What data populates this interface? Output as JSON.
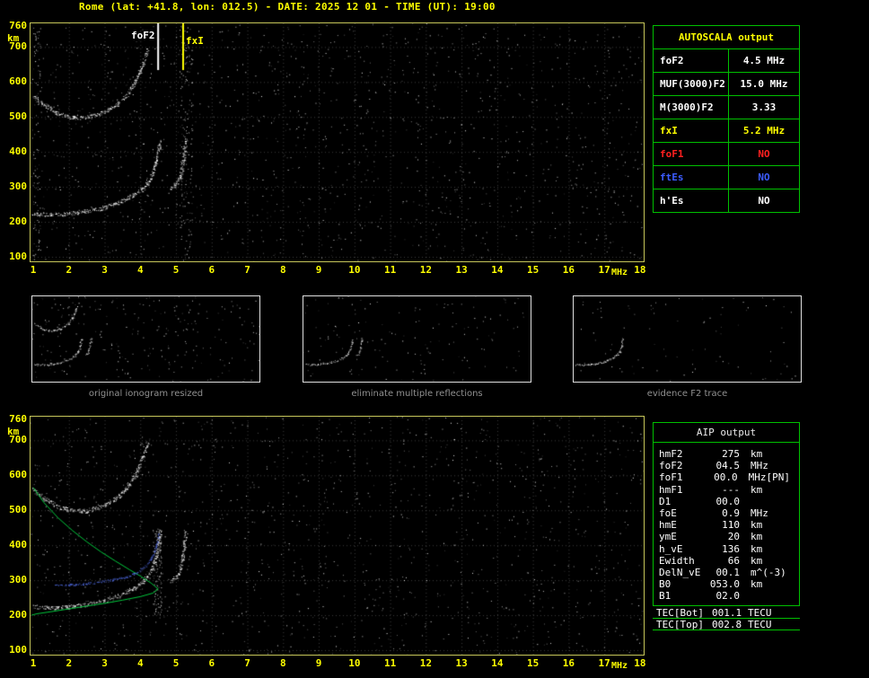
{
  "title": "Rome (lat: +41.8, lon: 012.5) - DATE: 2025 12 01 - TIME (UT): 19:00",
  "colors": {
    "accent_yellow": "#ffff00",
    "table_border_green": "#00c000",
    "plot_frame_yellow": "#c6c65a",
    "caption_gray": "#909090",
    "profile_green": "#00c83c",
    "scaled_trace_blue": "#5a78ff",
    "no_red": "#ff2020",
    "es_blue": "#3c5cff"
  },
  "autoscala": {
    "title": "AUTOSCALA output",
    "rows": [
      {
        "label": "foF2",
        "value": "4.5 MHz",
        "color": "#ffffff"
      },
      {
        "label": "MUF(3000)F2",
        "value": "15.0 MHz",
        "color": "#ffffff"
      },
      {
        "label": "M(3000)F2",
        "value": "3.33",
        "color": "#ffffff"
      },
      {
        "label": "fxI",
        "value": "5.2 MHz",
        "color": "#ffff00"
      },
      {
        "label": "foF1",
        "value": "NO",
        "color": "#ff2020"
      },
      {
        "label": "ftEs",
        "value": "NO",
        "color": "#3c5cff"
      },
      {
        "label": "h'Es",
        "value": "NO",
        "color": "#ffffff"
      }
    ]
  },
  "aip": {
    "title": "AIP output",
    "rows": [
      {
        "label": "hmF2",
        "value": "275",
        "unit": "km",
        "note": ""
      },
      {
        "label": "foF2",
        "value": "04.5",
        "unit": "MHz",
        "note": ""
      },
      {
        "label": "foF1",
        "value": "00.0",
        "unit": "MHz",
        "note": "[PN]"
      },
      {
        "label": "hmF1",
        "value": "---",
        "unit": "km",
        "note": ""
      },
      {
        "label": "D1",
        "value": "00.0",
        "unit": "",
        "note": ""
      },
      {
        "label": "foE",
        "value": "0.9",
        "unit": "MHz",
        "note": ""
      },
      {
        "label": "hmE",
        "value": "110",
        "unit": "km",
        "note": ""
      },
      {
        "label": "ymE",
        "value": "20",
        "unit": "km",
        "note": ""
      },
      {
        "label": "h_vE",
        "value": "136",
        "unit": "km",
        "note": ""
      },
      {
        "label": "Ewidth",
        "value": "66",
        "unit": "km",
        "note": ""
      },
      {
        "label": "DelN_vE",
        "value": "00.1",
        "unit": "m^(-3)",
        "note": ""
      },
      {
        "label": "B0",
        "value": "053.0",
        "unit": "km",
        "note": ""
      },
      {
        "label": "B1",
        "value": "02.0",
        "unit": "",
        "note": ""
      }
    ],
    "tec_rows": [
      {
        "label": "TEC[Bot]",
        "value": "001.1",
        "unit": "TECU"
      },
      {
        "label": "TEC[Top]",
        "value": "002.8",
        "unit": "TECU"
      }
    ]
  },
  "thumbnails": [
    {
      "caption": "original ionogram resized"
    },
    {
      "caption": "eliminate multiple reflections"
    },
    {
      "caption": "evidence F2 trace"
    }
  ],
  "chart_data": [
    {
      "name": "main-ionogram",
      "type": "scatter",
      "xlabel": "MHz",
      "ylabel": "km",
      "xlim": [
        1,
        18
      ],
      "ylim": [
        100,
        760
      ],
      "grid": true,
      "x_ticks": [
        1,
        2,
        3,
        4,
        5,
        6,
        7,
        8,
        9,
        10,
        11,
        12,
        13,
        14,
        15,
        16,
        17,
        18
      ],
      "y_ticks": [
        760,
        700,
        600,
        500,
        400,
        300,
        200,
        100
      ],
      "markers": [
        {
          "label": "foF2",
          "MHz": 4.5,
          "color": "#ffffff"
        },
        {
          "label": "fxI",
          "MHz": 5.2,
          "color": "#ffff00"
        }
      ],
      "traces": [
        {
          "name": "F2-first-hop",
          "color": "#ffffff",
          "points": [
            [
              1.0,
              225
            ],
            [
              1.5,
              221
            ],
            [
              2.0,
              224
            ],
            [
              2.5,
              231
            ],
            [
              3.0,
              242
            ],
            [
              3.4,
              256
            ],
            [
              3.8,
              276
            ],
            [
              4.1,
              300
            ],
            [
              4.3,
              328
            ],
            [
              4.45,
              372
            ],
            [
              4.55,
              432
            ]
          ]
        },
        {
          "name": "F2-second-hop",
          "color": "#ffffff",
          "points": [
            [
              1.0,
              560
            ],
            [
              1.3,
              534
            ],
            [
              1.7,
              510
            ],
            [
              2.1,
              499
            ],
            [
              2.5,
              499
            ],
            [
              2.9,
              511
            ],
            [
              3.3,
              533
            ],
            [
              3.6,
              561
            ],
            [
              3.85,
              601
            ],
            [
              4.05,
              648
            ],
            [
              4.2,
              692
            ]
          ]
        },
        {
          "name": "X-mode-segment",
          "color": "#ffffff",
          "points": [
            [
              4.85,
              298
            ],
            [
              5.0,
              309
            ],
            [
              5.1,
              329
            ],
            [
              5.18,
              364
            ],
            [
              5.23,
              408
            ],
            [
              5.26,
              438
            ]
          ]
        }
      ]
    },
    {
      "name": "profile-ionogram",
      "type": "scatter",
      "xlabel": "MHz",
      "ylabel": "km",
      "xlim": [
        1,
        18
      ],
      "ylim": [
        100,
        760
      ],
      "grid": true,
      "x_ticks": [
        1,
        2,
        3,
        4,
        5,
        6,
        7,
        8,
        9,
        10,
        11,
        12,
        13,
        14,
        15,
        16,
        17,
        18
      ],
      "y_ticks": [
        760,
        700,
        600,
        500,
        400,
        300,
        200,
        100
      ],
      "traces": [
        {
          "name": "F2-first-hop",
          "color": "#ffffff",
          "points": [
            [
              1.0,
              225
            ],
            [
              1.5,
              221
            ],
            [
              2.0,
              224
            ],
            [
              2.5,
              231
            ],
            [
              3.0,
              242
            ],
            [
              3.4,
              256
            ],
            [
              3.8,
              276
            ],
            [
              4.1,
              300
            ],
            [
              4.3,
              328
            ],
            [
              4.45,
              372
            ],
            [
              4.55,
              432
            ]
          ]
        },
        {
          "name": "F2-second-hop",
          "color": "#ffffff",
          "points": [
            [
              1.0,
              560
            ],
            [
              1.3,
              534
            ],
            [
              1.7,
              510
            ],
            [
              2.1,
              499
            ],
            [
              2.5,
              499
            ],
            [
              2.9,
              511
            ],
            [
              3.3,
              533
            ],
            [
              3.6,
              561
            ],
            [
              3.85,
              601
            ],
            [
              4.05,
              648
            ],
            [
              4.2,
              692
            ]
          ]
        },
        {
          "name": "X-mode-segment",
          "color": "#ffffff",
          "points": [
            [
              4.85,
              298
            ],
            [
              5.0,
              309
            ],
            [
              5.1,
              329
            ],
            [
              5.18,
              364
            ],
            [
              5.23,
              408
            ],
            [
              5.26,
              438
            ]
          ]
        }
      ],
      "profile": {
        "name": "electron-density-profile",
        "color": "#00c83c",
        "points": [
          [
            1.0,
            565
          ],
          [
            1.3,
            522
          ],
          [
            1.7,
            478
          ],
          [
            2.1,
            442
          ],
          [
            2.5,
            410
          ],
          [
            2.9,
            381
          ],
          [
            3.3,
            355
          ],
          [
            3.7,
            330
          ],
          [
            4.0,
            312
          ],
          [
            4.3,
            292
          ],
          [
            4.5,
            275
          ],
          [
            4.35,
            263
          ],
          [
            4.0,
            253
          ],
          [
            3.5,
            243
          ],
          [
            3.0,
            234
          ],
          [
            2.5,
            226
          ],
          [
            2.0,
            218
          ],
          [
            1.5,
            210
          ],
          [
            1.1,
            204
          ],
          [
            0.95,
            200
          ]
        ]
      },
      "scaled_f2_trace": {
        "name": "autoscala-restored-trace",
        "color": "#5a78ff",
        "points": [
          [
            1.6,
            285
          ],
          [
            2.0,
            287
          ],
          [
            2.4,
            290
          ],
          [
            2.8,
            295
          ],
          [
            3.2,
            301
          ],
          [
            3.6,
            310
          ],
          [
            3.9,
            322
          ],
          [
            4.15,
            341
          ],
          [
            4.32,
            366
          ],
          [
            4.45,
            400
          ],
          [
            4.52,
            432
          ]
        ]
      }
    }
  ]
}
